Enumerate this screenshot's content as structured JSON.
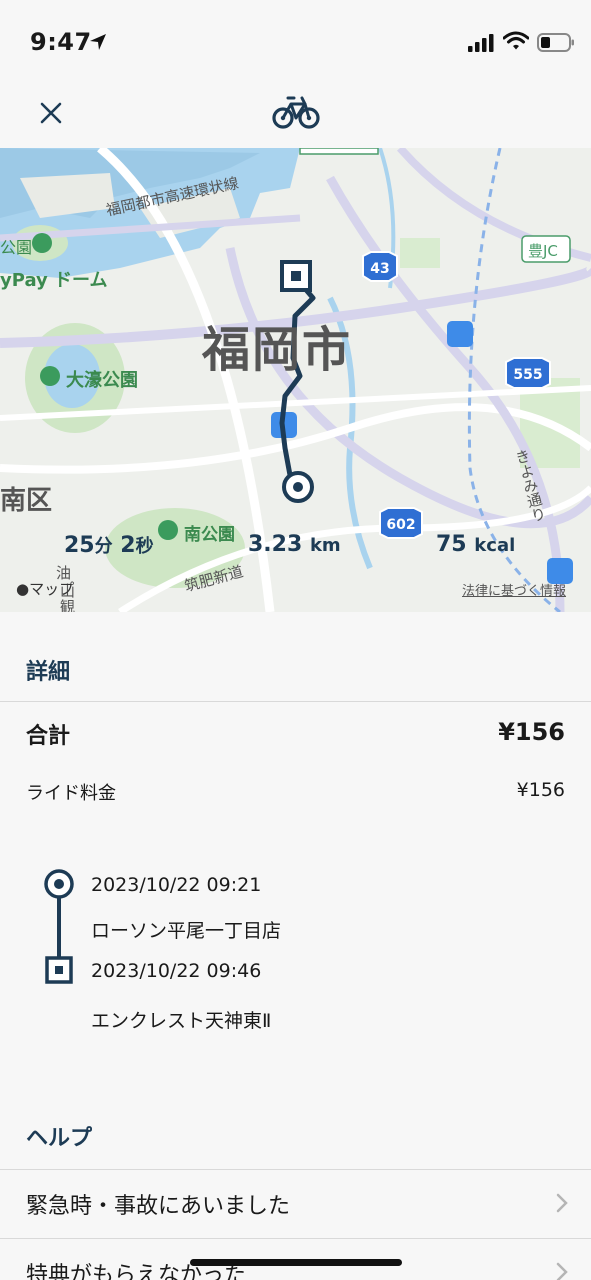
{
  "status_bar": {
    "time": "9:47"
  },
  "map": {
    "city": "福岡市",
    "place_labels": [
      "福岡都市高速環状線",
      "公園",
      "yPay ドーム",
      "大濠公園",
      "南公園",
      "南区",
      "筑肥新道",
      "豊JC",
      "きよみ通り",
      "油",
      "山",
      "観"
    ],
    "route_badges": [
      "43",
      "555",
      "602"
    ],
    "attribution": "マップ",
    "legal": "法律に基づく情報"
  },
  "stats": {
    "duration_min": "25",
    "duration_min_unit": "分",
    "duration_sec": "2",
    "duration_sec_unit": "秒",
    "distance": "3.23",
    "distance_unit": "km",
    "calories": "75",
    "calories_unit": "kcal"
  },
  "details": {
    "heading": "詳細",
    "total_label": "合計",
    "total_value": "¥156",
    "fee_label": "ライド料金",
    "fee_value": "¥156"
  },
  "trip": {
    "start_time": "2023/10/22 09:21",
    "start_place": "ローソン平尾一丁目店",
    "end_time": "2023/10/22 09:46",
    "end_place": "エンクレスト天神東Ⅱ"
  },
  "help": {
    "heading": "ヘルプ",
    "items": [
      "緊急時・事故にあいました",
      "特典がもらえなかった"
    ]
  },
  "colors": {
    "accent": "#1d3b55",
    "map_water": "#a9d3ee",
    "map_park": "#cfe6c5"
  }
}
